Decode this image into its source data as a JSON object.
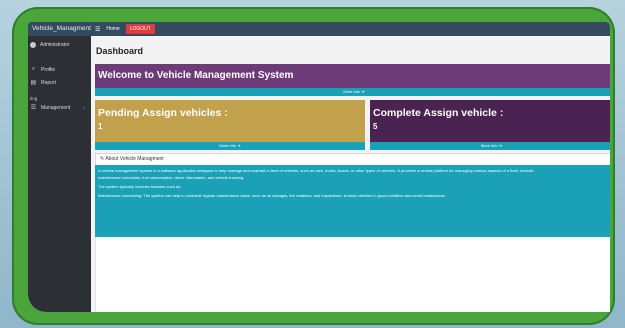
{
  "app": {
    "brand": "Vehicle_Managment"
  },
  "topbar": {
    "home": "Home",
    "logout": "LOGOUT"
  },
  "sidebar": {
    "user": "Administrator",
    "items": [
      {
        "label": "Profile"
      },
      {
        "label": "Report"
      }
    ],
    "section": "ting",
    "management": "Management"
  },
  "main": {
    "title": "Dashboard",
    "welcome": "Welcome to Vehicle Management System",
    "more_info": "More info"
  },
  "cards": {
    "pending": {
      "title": "Pending Assign vehicles :",
      "count": "1"
    },
    "complete": {
      "title": "Complete Assign vehicle :",
      "count": "5"
    }
  },
  "about": {
    "heading": "About Vehicle Managment",
    "p1": "A vehicle management system is a software application designed to help manage and maintain a fleet of vehicles, such as cars, trucks, buses, or other types of vehicles. It provides a central platform for managing various aspects of a fleet, includin",
    "p1b": "maintenance schedules, fuel consumption, driver information, and vehicle tracking.",
    "p2": "The system typically includes features such as:",
    "p3": "Maintenance scheduling: The system can help to schedule regular maintenance tasks, such as oil changes, tire rotations, and inspections, to keep vehicles in good condition and avoid breakdowns"
  },
  "colors": {
    "green_frame": "#4aa53b",
    "sidebar": "#2c3035",
    "topbar": "#334a5f",
    "welcome": "#6c3b78",
    "pending": "#c2a14d",
    "complete": "#4a2352",
    "teal": "#1aa1b8",
    "logout": "#e03b3b"
  }
}
